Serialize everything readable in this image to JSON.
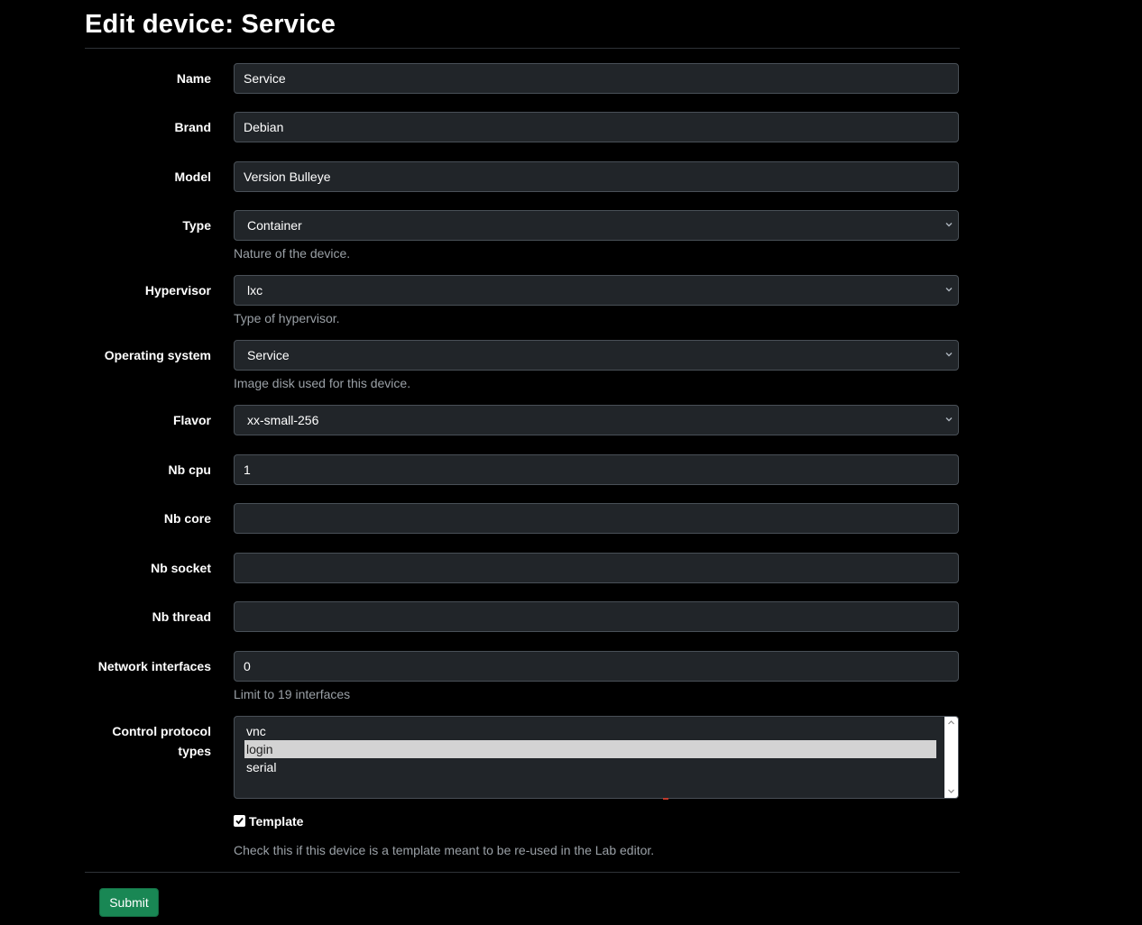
{
  "page": {
    "title": "Edit device: Service"
  },
  "form": {
    "name": {
      "label": "Name",
      "value": "Service"
    },
    "brand": {
      "label": "Brand",
      "value": "Debian"
    },
    "model": {
      "label": "Model",
      "value": "Version Bulleye"
    },
    "type": {
      "label": "Type",
      "value": "Container",
      "help": "Nature of the device."
    },
    "hypervisor": {
      "label": "Hypervisor",
      "value": "lxc",
      "help": "Type of hypervisor."
    },
    "os": {
      "label": "Operating system",
      "value": "Service",
      "help": "Image disk used for this device."
    },
    "flavor": {
      "label": "Flavor",
      "value": "xx-small-256"
    },
    "nb_cpu": {
      "label": "Nb cpu",
      "value": "1"
    },
    "nb_core": {
      "label": "Nb core",
      "value": ""
    },
    "nb_socket": {
      "label": "Nb socket",
      "value": ""
    },
    "nb_thread": {
      "label": "Nb thread",
      "value": ""
    },
    "network_interfaces": {
      "label": "Network interfaces",
      "value": "0",
      "help": "Limit to 19 interfaces"
    },
    "control_protocols": {
      "label_line1": "Control protocol",
      "label_line2": "types",
      "options": [
        "vnc",
        "login",
        "serial"
      ],
      "selected": "login"
    },
    "template": {
      "label": "Template",
      "checked": true,
      "help": "Check this if this device is a template meant to be re-used in the Lab editor."
    },
    "submit_label": "Submit"
  },
  "icons": {
    "select_chevron": "chevron-down-icon",
    "checkbox_mark": "checkmark-icon"
  },
  "colors": {
    "background": "#000000",
    "input_bg": "#212529",
    "submit": "#198754"
  }
}
